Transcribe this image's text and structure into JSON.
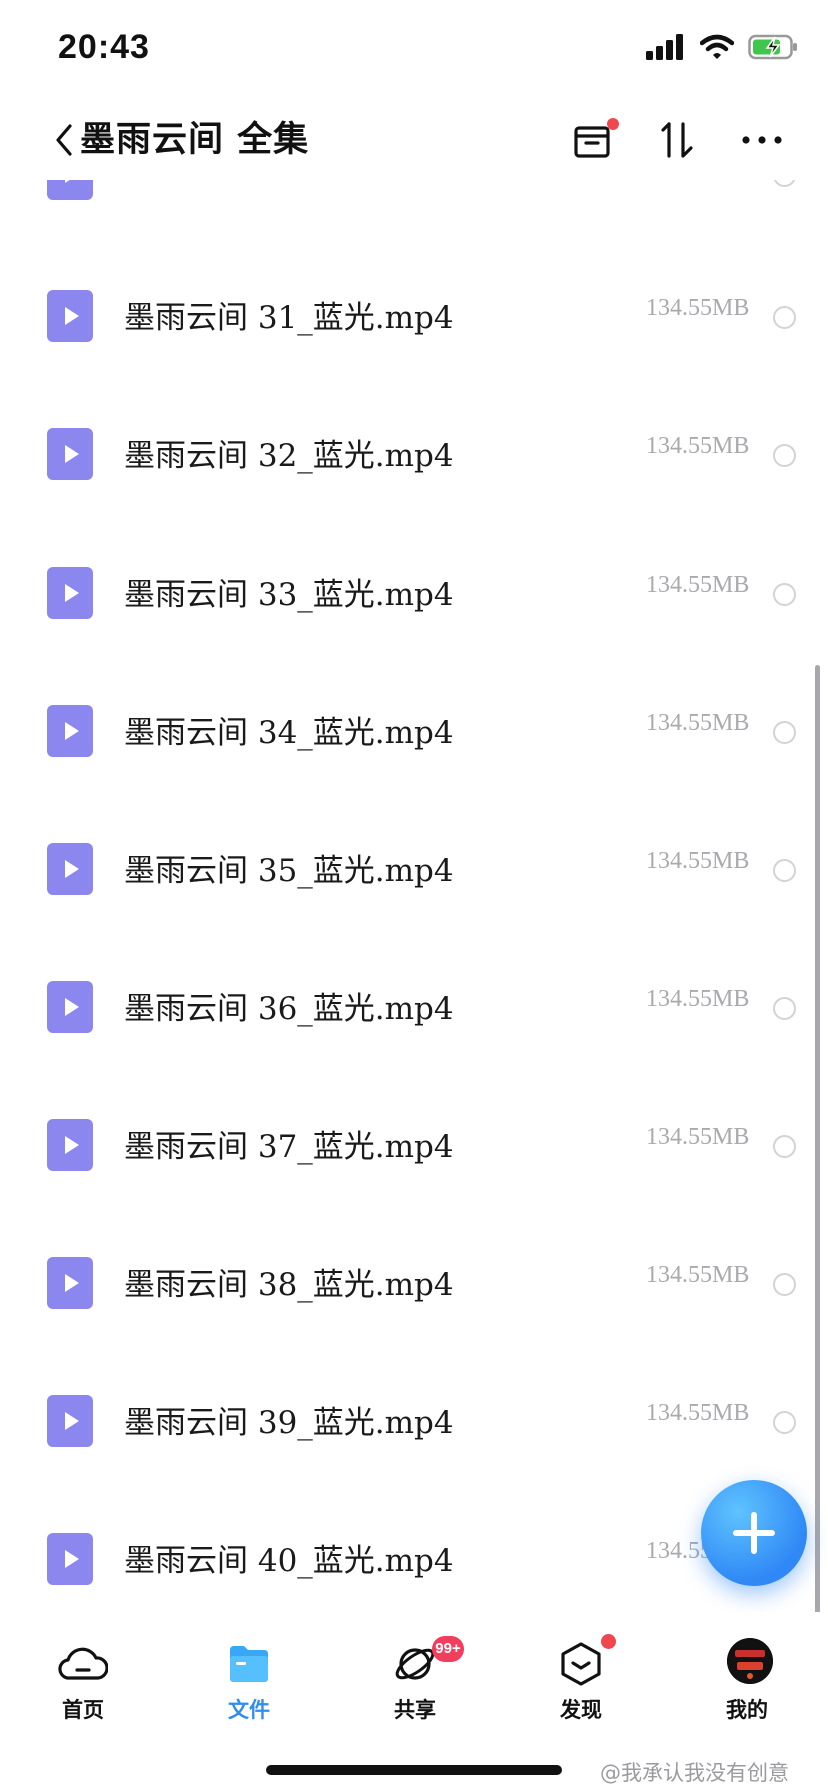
{
  "status_bar": {
    "time": "20:43"
  },
  "header": {
    "title": "墨雨云间 全集"
  },
  "files": [
    {
      "name": "",
      "size": ""
    },
    {
      "name": "墨雨云间 31_蓝光.mp4",
      "size": "134.55MB"
    },
    {
      "name": "墨雨云间 32_蓝光.mp4",
      "size": "134.55MB"
    },
    {
      "name": "墨雨云间 33_蓝光.mp4",
      "size": "134.55MB"
    },
    {
      "name": "墨雨云间 34_蓝光.mp4",
      "size": "134.55MB"
    },
    {
      "name": "墨雨云间 35_蓝光.mp4",
      "size": "134.55MB"
    },
    {
      "name": "墨雨云间 36_蓝光.mp4",
      "size": "134.55MB"
    },
    {
      "name": "墨雨云间 37_蓝光.mp4",
      "size": "134.55MB"
    },
    {
      "name": "墨雨云间 38_蓝光.mp4",
      "size": "134.55MB"
    },
    {
      "name": "墨雨云间 39_蓝光.mp4",
      "size": "134.55MB"
    },
    {
      "name": "墨雨云间 40_蓝光.mp4",
      "size": "134.55MB"
    }
  ],
  "tabs": [
    {
      "label": "首页",
      "icon": "cloud-home-icon"
    },
    {
      "label": "文件",
      "icon": "folder-icon",
      "active": true
    },
    {
      "label": "共享",
      "icon": "share-orbit-icon",
      "badge": "99+"
    },
    {
      "label": "发现",
      "icon": "discover-box-icon",
      "dot": true
    },
    {
      "label": "我的",
      "icon": "avatar"
    }
  ],
  "watermark": "@我承认我没有创意",
  "colors": {
    "accent": "#2f8df0",
    "file_icon": "#8b87ee",
    "badge": "#f23d5c"
  }
}
